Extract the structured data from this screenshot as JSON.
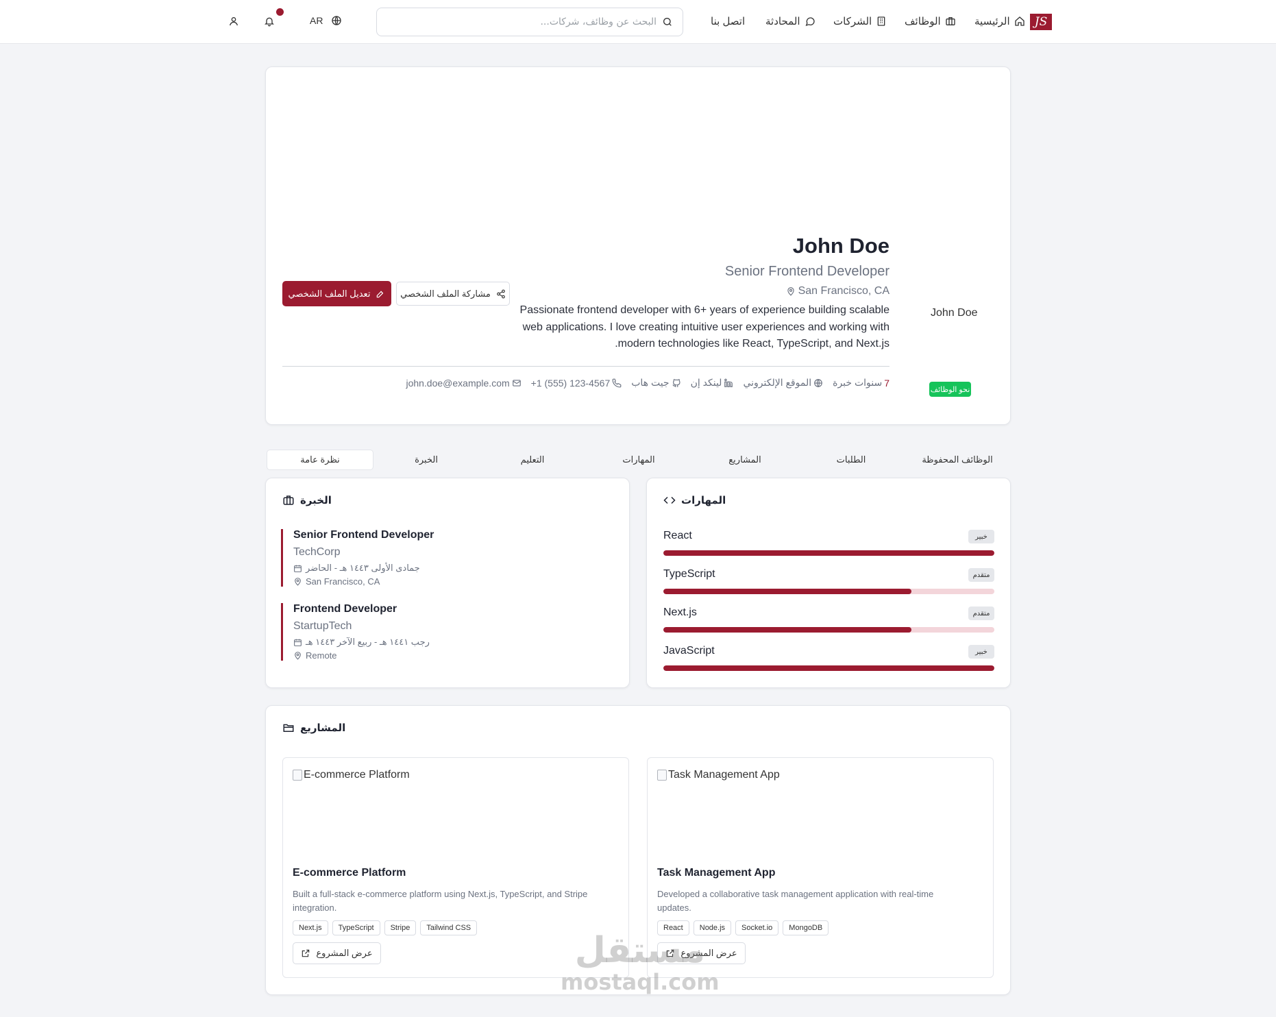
{
  "nav": {
    "logo_text": "JS",
    "items": [
      {
        "label": "الرئيسية",
        "icon": "home-icon"
      },
      {
        "label": "الوظائف",
        "icon": "briefcase-icon"
      },
      {
        "label": "الشركات",
        "icon": "building-icon"
      },
      {
        "label": "المحادثة",
        "icon": "chat-icon"
      },
      {
        "label": "اتصل بنا",
        "icon": ""
      }
    ],
    "search_placeholder": "البحث عن وظائف، شركات...",
    "language": "AR"
  },
  "profile": {
    "name": "John Doe",
    "title": "Senior Frontend Developer",
    "location": "San Francisco, CA",
    "bio": "Passionate frontend developer with 6+ years of experience building scalable web applications. I love creating intuitive user experiences and working with modern technologies like React, TypeScript, and Next.js.",
    "avatar_alt": "John Doe",
    "edit_button": "تعديل الملف الشخصي",
    "share_button": "مشاركة الملف الشخصي",
    "experience_years": "7",
    "experience_label": "سنوات خبرة",
    "website_label": "الموقع الإلكتروني",
    "linkedin_label": "لينكد إن",
    "github_label": "جيت هاب",
    "phone": "+1 (555) 123-4567",
    "email": "john.doe@example.com",
    "status_badge": "نحو الوظائف"
  },
  "tabs": [
    "نظرة عامة",
    "الخبرة",
    "التعليم",
    "المهارات",
    "المشاريع",
    "الطلبات",
    "الوظائف المحفوظة"
  ],
  "skills": {
    "title": "المهارات",
    "items": [
      {
        "name": "React",
        "level": "خبير",
        "percent": 100
      },
      {
        "name": "TypeScript",
        "level": "متقدم",
        "percent": 75
      },
      {
        "name": "Next.js",
        "level": "متقدم",
        "percent": 75
      },
      {
        "name": "JavaScript",
        "level": "خبير",
        "percent": 100
      }
    ]
  },
  "experience": {
    "title": "الخبرة",
    "items": [
      {
        "role": "Senior Frontend Developer",
        "company": "TechCorp",
        "dates": "جمادى الأولى ١٤٤٣ هـ - الحاضر",
        "location": "San Francisco, CA"
      },
      {
        "role": "Frontend Developer",
        "company": "StartupTech",
        "dates": "رجب ١٤٤١ هـ - ربيع الآخر ١٤٤٣ هـ",
        "location": "Remote"
      }
    ]
  },
  "projects": {
    "title": "المشاريع",
    "view_label": "عرض المشروع",
    "items": [
      {
        "image_alt": "E-commerce Platform",
        "title": "E-commerce Platform",
        "description": "Built a full-stack e-commerce platform using Next.js, TypeScript, and Stripe integration.",
        "tags": [
          "Next.js",
          "TypeScript",
          "Stripe",
          "Tailwind CSS"
        ]
      },
      {
        "image_alt": "Task Management App",
        "title": "Task Management App",
        "description": "Developed a collaborative task management application with real-time updates.",
        "tags": [
          "React",
          "Node.js",
          "Socket.io",
          "MongoDB"
        ]
      }
    ]
  },
  "watermark": {
    "arabic": "مستقل",
    "latin": "mostaql.com"
  },
  "colors": {
    "accent": "#9b1b30",
    "status_green": "#16c35a",
    "background": "#f3f4f7"
  }
}
